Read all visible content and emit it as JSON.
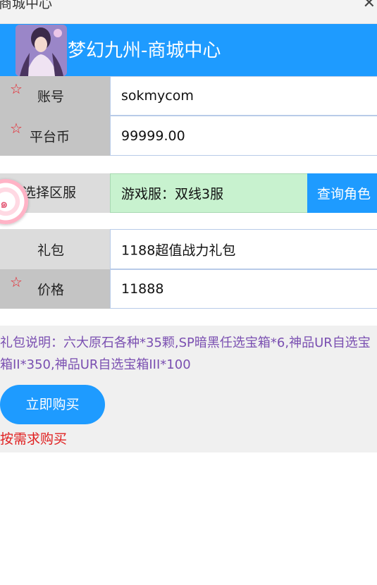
{
  "topbar": {
    "title": "商城中心",
    "close_glyph": "✕"
  },
  "header": {
    "title": "梦幻九州-商城中心",
    "logo_icon": "game-avatar-icon"
  },
  "form": {
    "account": {
      "label": "账号",
      "value": "sokmycom"
    },
    "coin": {
      "label": "平台币",
      "value": "99999.00"
    },
    "server": {
      "label": "选择区服",
      "value": "游戏服：双线3服",
      "query_label": "查询角色"
    },
    "gift": {
      "label": "礼包",
      "value": "1188超值战力礼包"
    },
    "price": {
      "label": "价格",
      "value": "11888"
    }
  },
  "required_mark": "☆",
  "info": {
    "description": "礼包说明：六大原石各种*35颗,SP暗黑任选宝箱*6,神品UR自选宝箱II*350,神品UR自选宝箱III*100",
    "buy_label": "立即购买",
    "note": "按需求购买"
  },
  "colors": {
    "accent": "#1e9bff",
    "required": "#e8202a",
    "description": "#7a4fb1",
    "note": "#e02020",
    "server_field": "#c8f2cf"
  }
}
